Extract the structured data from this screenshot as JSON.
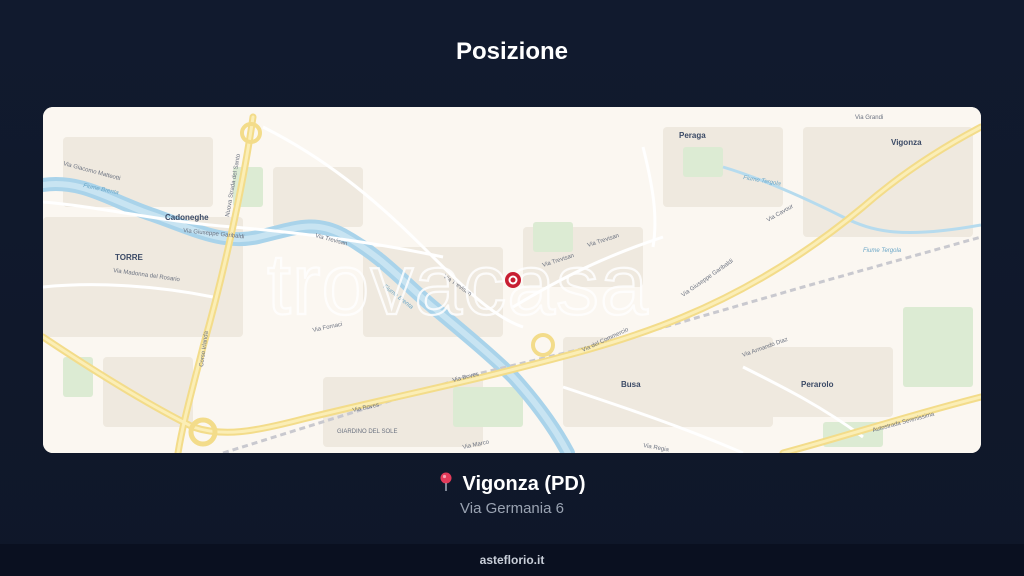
{
  "header": {
    "title": "Posizione"
  },
  "map": {
    "watermark": "trovacasa",
    "towns": [
      "Cadoneghe",
      "TORRE",
      "Peraga",
      "Vigonza",
      "Busa",
      "Perarolo"
    ],
    "roads": [
      "Via Giacomo Matteotti",
      "Via Giuseppe Garibaldi",
      "Via Trevisan",
      "Via Boves",
      "Via del Commercio",
      "Via Giuseppe Garibaldi",
      "Via Cavour",
      "Via Grandi",
      "Via Regia",
      "Via Armando Diaz",
      "Autostrada Serenissima",
      "Nuova Strada del Santo",
      "Corso Irlanda",
      "Via Marco",
      "Via Madonna del Rosario",
      "Via Fornaci"
    ],
    "waterways": [
      "Fiume Brenta",
      "Fiume Tergola"
    ],
    "places": [
      "GIARDINO DEL SOLE"
    ],
    "marker_color": "#c81e32"
  },
  "location": {
    "icon": "pin-icon",
    "name": "Vigonza (PD)",
    "address": "Via Germania 6"
  },
  "footer": {
    "site": "asteflorio.it"
  }
}
